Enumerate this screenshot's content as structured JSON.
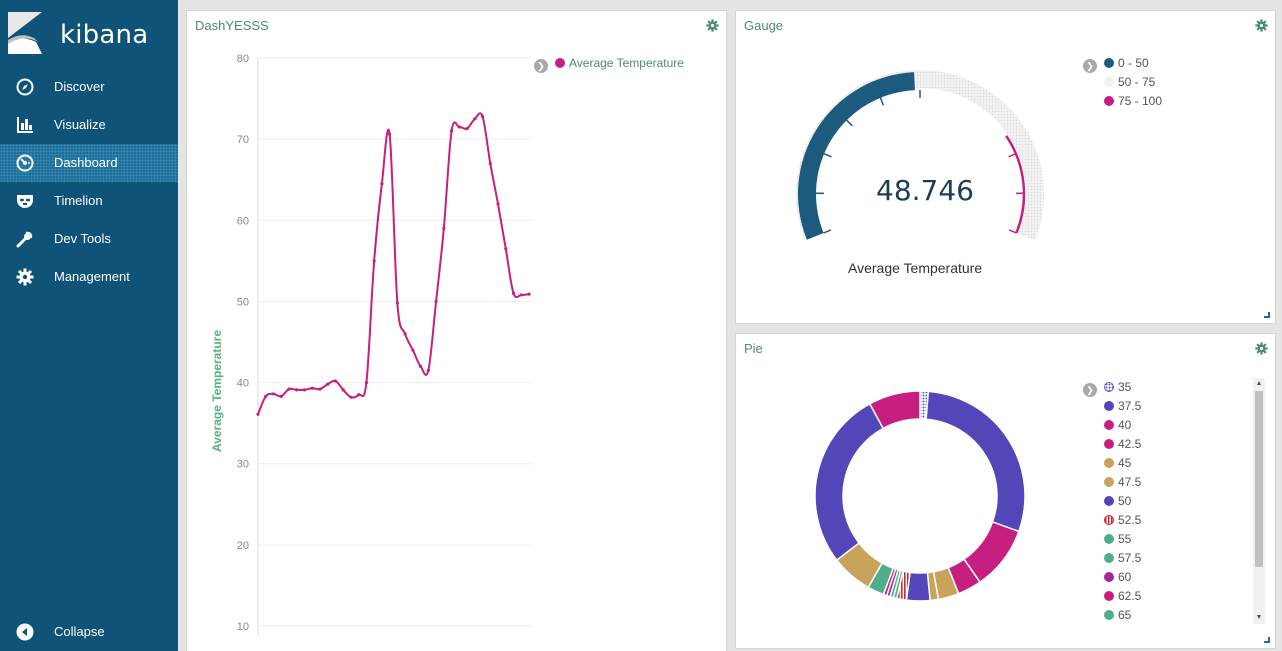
{
  "sidebar": {
    "brand": "kibana",
    "items": [
      {
        "label": "Discover",
        "icon": "compass-icon"
      },
      {
        "label": "Visualize",
        "icon": "bar-chart-icon"
      },
      {
        "label": "Dashboard",
        "icon": "dashboard-icon",
        "active": true
      },
      {
        "label": "Timelion",
        "icon": "timelion-mask-icon"
      },
      {
        "label": "Dev Tools",
        "icon": "wrench-icon"
      },
      {
        "label": "Management",
        "icon": "gear-icon"
      }
    ],
    "collapse_label": "Collapse",
    "colors": {
      "background": "#0f5378",
      "active": "#1a6f9c"
    }
  },
  "panels": {
    "line": {
      "title": "DashYESSS",
      "legend": "Average Temperature"
    },
    "gauge": {
      "title": "Gauge",
      "value_text": "48.746",
      "label": "Average Temperature",
      "legend": [
        {
          "label": "0 - 50",
          "color": "#1c5a7e"
        },
        {
          "label": "50 - 75",
          "color": "#f0f0f0"
        },
        {
          "label": "75 - 100",
          "color": "#c71f80"
        }
      ]
    },
    "pie": {
      "title": "Pie",
      "legend": [
        {
          "label": "35",
          "color": "#5c5cc8",
          "pattern": "dots"
        },
        {
          "label": "37.5",
          "color": "#5346b8"
        },
        {
          "label": "40",
          "color": "#c71f80"
        },
        {
          "label": "42.5",
          "color": "#c71f80"
        },
        {
          "label": "45",
          "color": "#c9a35c"
        },
        {
          "label": "47.5",
          "color": "#c9a35c"
        },
        {
          "label": "50",
          "color": "#5346b8"
        },
        {
          "label": "52.5",
          "color": "#c72b2b",
          "pattern": "stripes"
        },
        {
          "label": "55",
          "color": "#4fae8a"
        },
        {
          "label": "57.5",
          "color": "#4fae8a"
        },
        {
          "label": "60",
          "color": "#a82597"
        },
        {
          "label": "62.5",
          "color": "#c71f80"
        },
        {
          "label": "65",
          "color": "#4fae8a"
        }
      ]
    }
  },
  "chart_data": [
    {
      "type": "line",
      "ylabel": "Average Temperature",
      "ylim": [
        10,
        80
      ],
      "yticks": [
        10,
        20,
        30,
        40,
        50,
        60,
        70,
        80
      ],
      "grid": true,
      "series": [
        {
          "name": "Average Temperature",
          "color": "#c71f80",
          "x": [
            0,
            1,
            2,
            3,
            4,
            5,
            6,
            7,
            8,
            9,
            10,
            11,
            12,
            13,
            14,
            15,
            16,
            17,
            18,
            19,
            20,
            21,
            22,
            23,
            24,
            25,
            26,
            27,
            28,
            29,
            30,
            31,
            32,
            33,
            34,
            35
          ],
          "values": [
            36.1,
            38.3,
            38.6,
            38.3,
            39.2,
            39.1,
            39.1,
            39.3,
            39.2,
            39.8,
            40.2,
            39.1,
            38.2,
            38.5,
            40.0,
            55.0,
            64.5,
            70.6,
            49.8,
            46.0,
            44.0,
            42.0,
            41.5,
            50.0,
            59.0,
            71.0,
            71.5,
            71.3,
            72.5,
            72.8,
            67.0,
            62.0,
            56.5,
            51.0,
            50.8,
            50.9
          ]
        }
      ]
    },
    {
      "type": "gauge",
      "value": 48.746,
      "range": [
        0,
        100
      ],
      "bands": [
        {
          "from": 0,
          "to": 50,
          "color": "#1c5a7e"
        },
        {
          "from": 50,
          "to": 75,
          "color": "#f0f0f0"
        },
        {
          "from": 75,
          "to": 100,
          "color": "#c71f80"
        }
      ]
    },
    {
      "type": "pie",
      "donut": true,
      "slices": [
        {
          "label": "35",
          "value": 1.2,
          "color": "#5c5cc8"
        },
        {
          "label": "37.5",
          "value": 27.6,
          "color": "#5346b8"
        },
        {
          "label": "40",
          "value": 9.3,
          "color": "#c71f80"
        },
        {
          "label": "42.5",
          "value": 3.5,
          "color": "#c71f80"
        },
        {
          "label": "45",
          "value": 3.0,
          "color": "#c9a35c"
        },
        {
          "label": "47.5",
          "value": 1.2,
          "color": "#c9a35c"
        },
        {
          "label": "50",
          "value": 3.4,
          "color": "#5346b8"
        },
        {
          "label": "52.5",
          "value": 1.4,
          "color": "#c72b2b"
        },
        {
          "label": "55",
          "value": 0.5,
          "color": "#4fae8a"
        },
        {
          "label": "57.5",
          "value": 0.5,
          "color": "#4fae8a"
        },
        {
          "label": "60",
          "value": 0.5,
          "color": "#a82597"
        },
        {
          "label": "62.5",
          "value": 0.5,
          "color": "#c71f80"
        },
        {
          "label": "65",
          "value": 2.4,
          "color": "#4fae8a"
        },
        {
          "label": "",
          "value": 6.0,
          "color": "#c9a35c"
        },
        {
          "label": "",
          "value": 26.0,
          "color": "#5346b8"
        },
        {
          "label": "",
          "value": 7.5,
          "color": "#c71f80"
        }
      ]
    }
  ]
}
